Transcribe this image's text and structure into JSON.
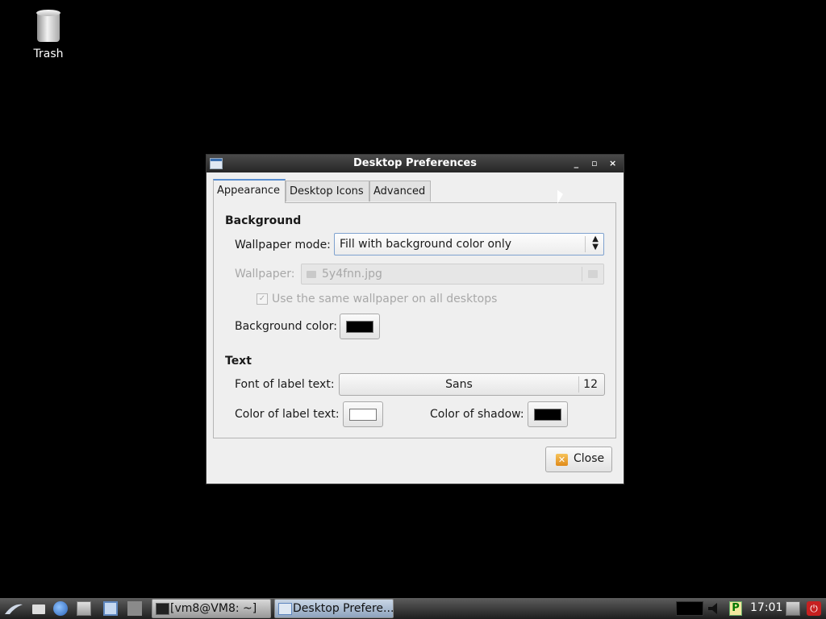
{
  "desktop": {
    "trash_label": "Trash"
  },
  "window": {
    "title": "Desktop Preferences",
    "controls": {
      "minimize": "_",
      "maximize": "▫",
      "close": "×"
    }
  },
  "tabs": [
    {
      "label": "Appearance",
      "active": true
    },
    {
      "label": "Desktop Icons",
      "active": false
    },
    {
      "label": "Advanced",
      "active": false
    }
  ],
  "background_section": {
    "heading": "Background",
    "wallpaper_mode_label": "Wallpaper mode:",
    "wallpaper_mode_value": "Fill with background color only",
    "wallpaper_label": "Wallpaper:",
    "wallpaper_file": "5y4fnn.jpg",
    "same_wallpaper_label": "Use the same wallpaper on all desktops",
    "same_wallpaper_checked": true,
    "background_color_label": "Background color:",
    "background_color": "#000000"
  },
  "text_section": {
    "heading": "Text",
    "font_label": "Font of label text:",
    "font_name": "Sans",
    "font_size": "12",
    "label_color_label": "Color of label text:",
    "label_color": "#ffffff",
    "shadow_color_label": "Color of shadow:",
    "shadow_color": "#000000"
  },
  "close_button": {
    "label": "Close",
    "icon": "close-icon"
  },
  "taskbar": {
    "tasks": [
      {
        "label": "[vm8@VM8: ~]",
        "icon": "terminal-icon"
      },
      {
        "label": "Desktop Prefere...",
        "icon": "window-icon"
      }
    ],
    "clock": "17:01"
  }
}
